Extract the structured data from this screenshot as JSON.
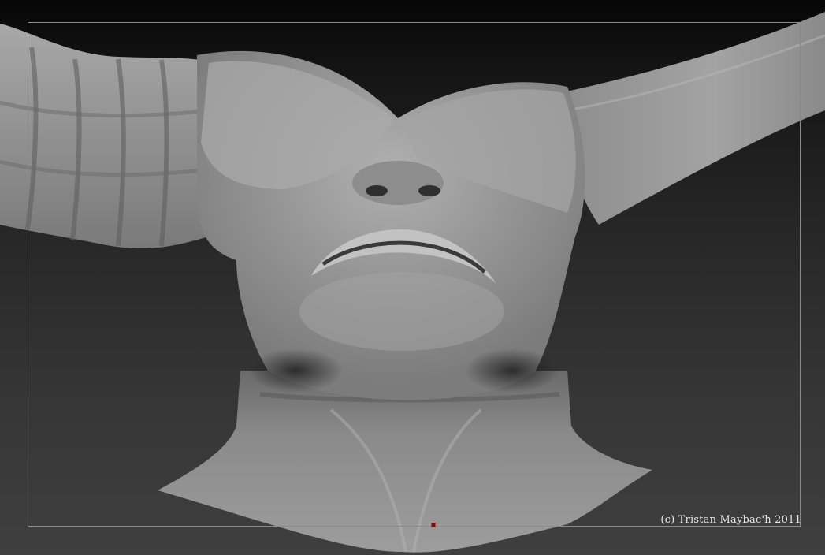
{
  "canvas": {
    "background_top": "#060606",
    "background_bottom": "#3f3f3f",
    "frame_color": "#8a8a8a",
    "model_color": "#9a9a9a"
  },
  "watermark": {
    "text": "(c) Tristan Maybac'h 2011"
  },
  "pivot_marker": {
    "color": "#d33030"
  }
}
